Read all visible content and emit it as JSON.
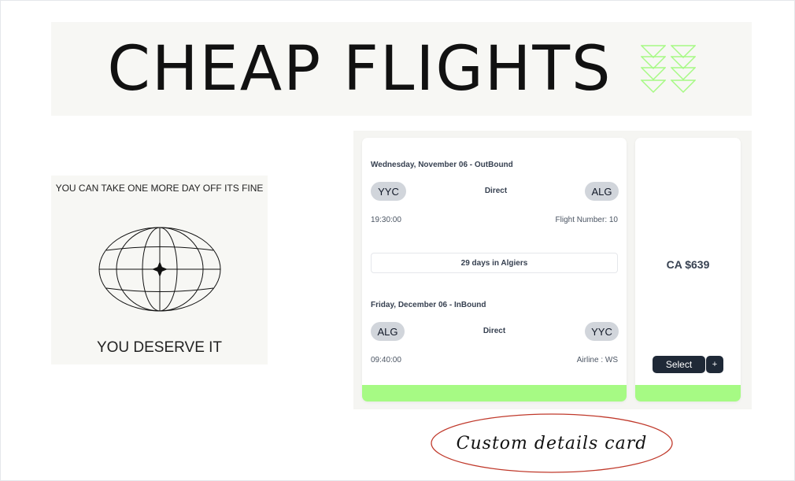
{
  "banner": {
    "title": "CHEAP FLIGHTS",
    "decoration_icon": "chevrons-down-icon",
    "decoration_color": "#a6fa84"
  },
  "promo": {
    "top_text": "YOU CAN TAKE ONE MORE DAY OFF ITS FINE",
    "bottom_text": "YOU DESERVE IT",
    "icon": "globe-icon"
  },
  "flight": {
    "outbound": {
      "date": "Wednesday, November 06 - OutBound",
      "from": "YYC",
      "to": "ALG",
      "stops": "Direct",
      "time": "19:30:00",
      "detail": "Flight Number: 10"
    },
    "stay": "29 days in Algiers",
    "inbound": {
      "date": "Friday, December 06 - InBound",
      "from": "ALG",
      "to": "YYC",
      "stops": "Direct",
      "time": "09:40:00",
      "detail": "Airline : WS"
    },
    "accent_color": "#a6fa84"
  },
  "pricing": {
    "price": "CA $639",
    "select_label": "Select",
    "add_label": "+"
  },
  "annotation": {
    "text": "Custom details card"
  }
}
